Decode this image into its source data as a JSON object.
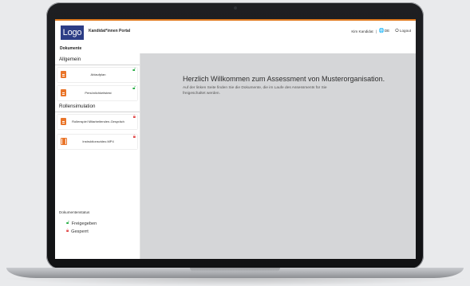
{
  "header": {
    "logo_text": "Logo",
    "portal_title": "Kandidat*innen Portal",
    "user_name": "Kim Kandidat",
    "separator": "|",
    "language": "DE",
    "logout_label": "Logout",
    "accent_color": "#e07a1f",
    "logo_color": "#2c3d86"
  },
  "subheader": {
    "title": "Dokumente"
  },
  "sidebar": {
    "sections": [
      {
        "title": "Allgemein",
        "documents": [
          {
            "name": "Ablaufplan",
            "icon": "document-icon",
            "status": "unlocked"
          },
          {
            "name": "Persönlichkeitstest",
            "icon": "document-icon",
            "status": "unlocked"
          }
        ]
      },
      {
        "title": "Rollensimulation",
        "documents": [
          {
            "name": "Rollenspiel Mitarbeitenden-Gespräch",
            "icon": "document-icon",
            "status": "locked"
          },
          {
            "name": "Instruktionsvideo.MP4",
            "icon": "video-icon",
            "status": "locked"
          }
        ]
      }
    ],
    "status_legend": {
      "title": "Dokumentenstatus",
      "released": "Freigegeben",
      "locked": "Gesperrt",
      "released_color": "#2cb04a",
      "locked_color": "#e04646"
    }
  },
  "main": {
    "welcome_title": "Herzlich Willkommen zum Assessment von Musterorganisation.",
    "welcome_text": "Auf der linken Seite finden Sie die Dokumente, die im Laufe des Assessments für Sie freigeschaltet werden."
  }
}
